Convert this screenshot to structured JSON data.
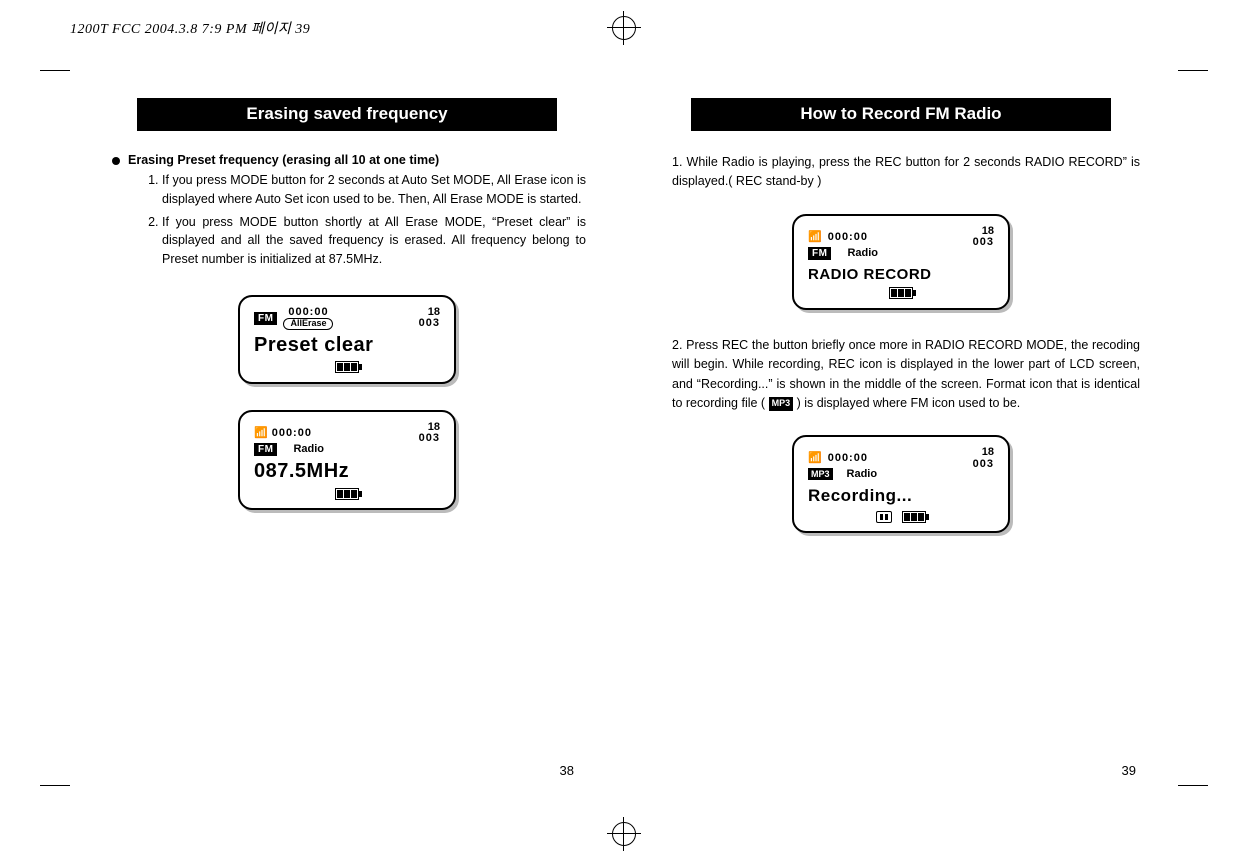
{
  "print_header": "1200T FCC  2004.3.8 7:9 PM  페이지 39",
  "left": {
    "title": "Erasing saved frequency",
    "bullet_heading": "Erasing Preset frequency (erasing all 10 at one time)",
    "step1": "If you press MODE button for 2 seconds at Auto Set MODE, All Erase icon is displayed where Auto Set icon used to be. Then, All Erase MODE is started.",
    "step2": "If you press MODE button shortly at All Erase MODE, “Preset clear” is displayed and all the saved frequency is erased. All frequency belong to Preset number is initialized at 87.5MHz.",
    "lcd1": {
      "fm": "FM",
      "time": "000:00",
      "allerase": "AllErase",
      "count_a": "18",
      "count_b": "003",
      "big": "Preset clear"
    },
    "lcd2": {
      "fm": "FM",
      "time": "000:00",
      "sub": "Radio",
      "count_a": "18",
      "count_b": "003",
      "big": "087.5MHz"
    },
    "page_num": "38"
  },
  "right": {
    "title": "How to Record FM Radio",
    "step1": "1. While Radio is playing, press the REC button for 2 seconds RADIO RECORD” is displayed.( REC stand-by )",
    "step2_a": "2. Press REC the button briefly once more in RADIO RECORD MODE, the recoding will begin. While recording, REC icon is displayed in the lower part of LCD screen, and “Recording...” is shown in the middle of the screen. Format icon that is identical to recording file ( ",
    "step2_b": " ) is displayed where FM icon used to be.",
    "mp3_inline": "MP3",
    "lcd1": {
      "fm": "FM",
      "time": "000:00",
      "sub": "Radio",
      "count_a": "18",
      "count_b": "003",
      "big": "RADIO RECORD"
    },
    "lcd2": {
      "mp3": "MP3",
      "time": "000:00",
      "sub": "Radio",
      "count_a": "18",
      "count_b": "003",
      "big": "Recording..."
    },
    "page_num": "39"
  }
}
